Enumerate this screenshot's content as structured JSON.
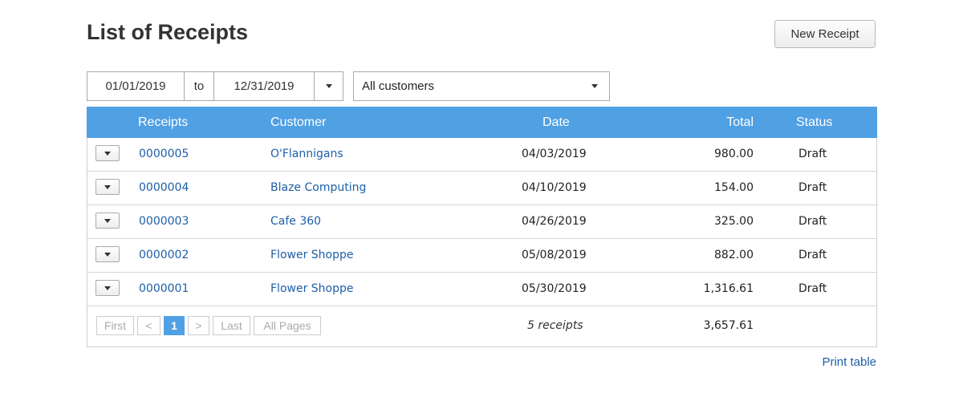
{
  "page": {
    "title": "List of Receipts",
    "new_button": "New Receipt",
    "print_link": "Print table"
  },
  "filters": {
    "date_from": "01/01/2019",
    "to_label": "to",
    "date_to": "12/31/2019",
    "customer": "All customers"
  },
  "table": {
    "headers": {
      "receipts": "Receipts",
      "customer": "Customer",
      "date": "Date",
      "total": "Total",
      "status": "Status"
    },
    "rows": [
      {
        "receipt": "0000005",
        "customer": "O'Flannigans",
        "date": "04/03/2019",
        "total": "980.00",
        "status": "Draft"
      },
      {
        "receipt": "0000004",
        "customer": "Blaze Computing",
        "date": "04/10/2019",
        "total": "154.00",
        "status": "Draft"
      },
      {
        "receipt": "0000003",
        "customer": "Cafe 360",
        "date": "04/26/2019",
        "total": "325.00",
        "status": "Draft"
      },
      {
        "receipt": "0000002",
        "customer": "Flower Shoppe",
        "date": "05/08/2019",
        "total": "882.00",
        "status": "Draft"
      },
      {
        "receipt": "0000001",
        "customer": "Flower Shoppe",
        "date": "05/30/2019",
        "total": "1,316.61",
        "status": "Draft"
      }
    ],
    "footer": {
      "count": "5 receipts",
      "total": "3,657.61"
    }
  },
  "pagination": {
    "first": "First",
    "prev": "<",
    "current": "1",
    "next": ">",
    "last": "Last",
    "all": "All Pages"
  },
  "colors": {
    "header_bg": "#50a0e4",
    "link": "#1d5fa8"
  }
}
